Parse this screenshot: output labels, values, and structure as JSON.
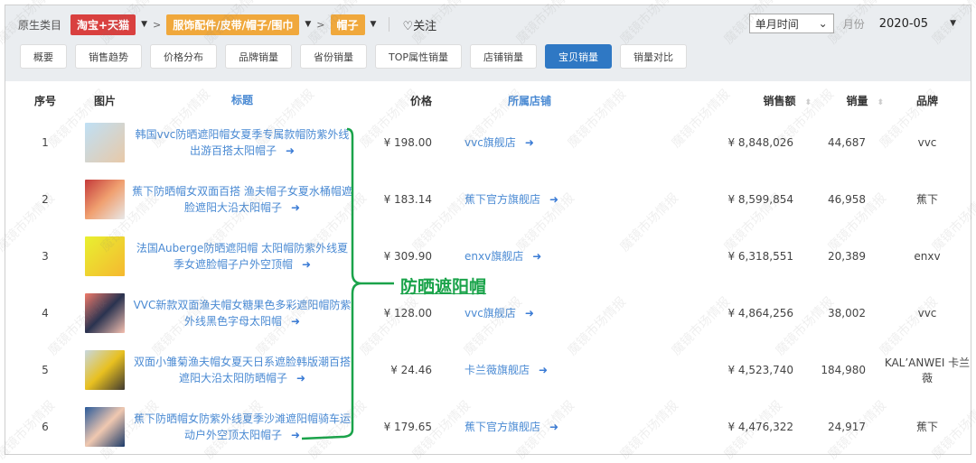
{
  "breadcrumb": {
    "label": "原生类目",
    "levels": [
      "淘宝+天猫",
      "服饰配件/皮带/帽子/围巾",
      "帽子"
    ],
    "follow": "关注"
  },
  "tabs": [
    "概要",
    "销售趋势",
    "价格分布",
    "品牌销量",
    "省份销量",
    "TOP属性销量",
    "店铺销量",
    "宝贝销量",
    "销量对比"
  ],
  "active_tab": "宝贝销量",
  "time_select": "单月时间",
  "month_label": "月份",
  "month": "2020-05",
  "columns": [
    "序号",
    "图片",
    "标题",
    "价格",
    "所属店铺",
    "销售额",
    "销量",
    "品牌"
  ],
  "rows": [
    {
      "idx": "1",
      "title": "韩国vvc防晒遮阳帽女夏季专属款帽防紫外线出游百搭太阳帽子",
      "price": "¥ 198.00",
      "shop": "vvc旗舰店",
      "sales": "¥ 8,848,026",
      "qty": "44,687",
      "brand": "vvc"
    },
    {
      "idx": "2",
      "title": "蕉下防晒帽女双面百搭 渔夫帽子女夏水桶帽遮脸遮阳大沿太阳帽子",
      "price": "¥ 183.14",
      "shop": "蕉下官方旗舰店",
      "sales": "¥ 8,599,854",
      "qty": "46,958",
      "brand": "蕉下"
    },
    {
      "idx": "3",
      "title": "法国Auberge防晒遮阳帽 太阳帽防紫外线夏季女遮脸帽子户外空顶帽",
      "price": "¥ 309.90",
      "shop": "enxv旗舰店",
      "sales": "¥ 6,318,551",
      "qty": "20,389",
      "brand": "enxv"
    },
    {
      "idx": "4",
      "title": "VVC新款双面渔夫帽女糖果色多彩遮阳帽防紫外线黑色字母太阳帽",
      "price": "¥ 128.00",
      "shop": "vvc旗舰店",
      "sales": "¥ 4,864,256",
      "qty": "38,002",
      "brand": "vvc"
    },
    {
      "idx": "5",
      "title": "双面小雏菊渔夫帽女夏天日系遮脸韩版潮百搭遮阳大沿太阳防晒帽子",
      "price": "¥ 24.46",
      "shop": "卡兰薇旗舰店",
      "sales": "¥ 4,523,740",
      "qty": "184,980",
      "brand": "KAL’ANWEI 卡兰薇"
    },
    {
      "idx": "6",
      "title": "蕉下防晒帽女防紫外线夏季沙滩遮阳帽骑车运动户外空顶太阳帽子",
      "price": "¥ 179.65",
      "shop": "蕉下官方旗舰店",
      "sales": "¥ 4,476,322",
      "qty": "24,917",
      "brand": "蕉下"
    }
  ],
  "annotation": "防晒遮阳帽",
  "watermark": "魔镜市场情报",
  "colors": {
    "accent": "#2f78c4",
    "link": "#4a8ad3",
    "annotation": "#1aa34a",
    "tag_red": "#d9403f",
    "tag_orange": "#f0a83c"
  }
}
